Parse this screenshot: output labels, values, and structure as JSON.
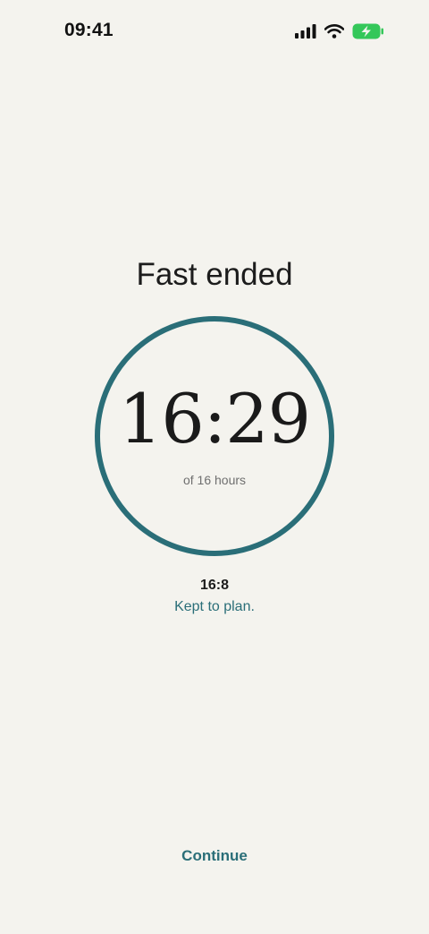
{
  "status_bar": {
    "time": "09:41",
    "icons": [
      "cellular-signal-icon",
      "wifi-icon",
      "battery-charging-icon"
    ],
    "battery_color": "#34c759"
  },
  "screen": {
    "title": "Fast ended",
    "timer": {
      "elapsed": "16:29",
      "goal_text": "of 16 hours",
      "ring_color": "#2a6e78"
    },
    "plan": {
      "name": "16:8",
      "status": "Kept to plan."
    },
    "continue_label": "Continue"
  },
  "colors": {
    "background": "#f4f3ee",
    "accent": "#2a6e78",
    "text": "#1c1c1c"
  }
}
